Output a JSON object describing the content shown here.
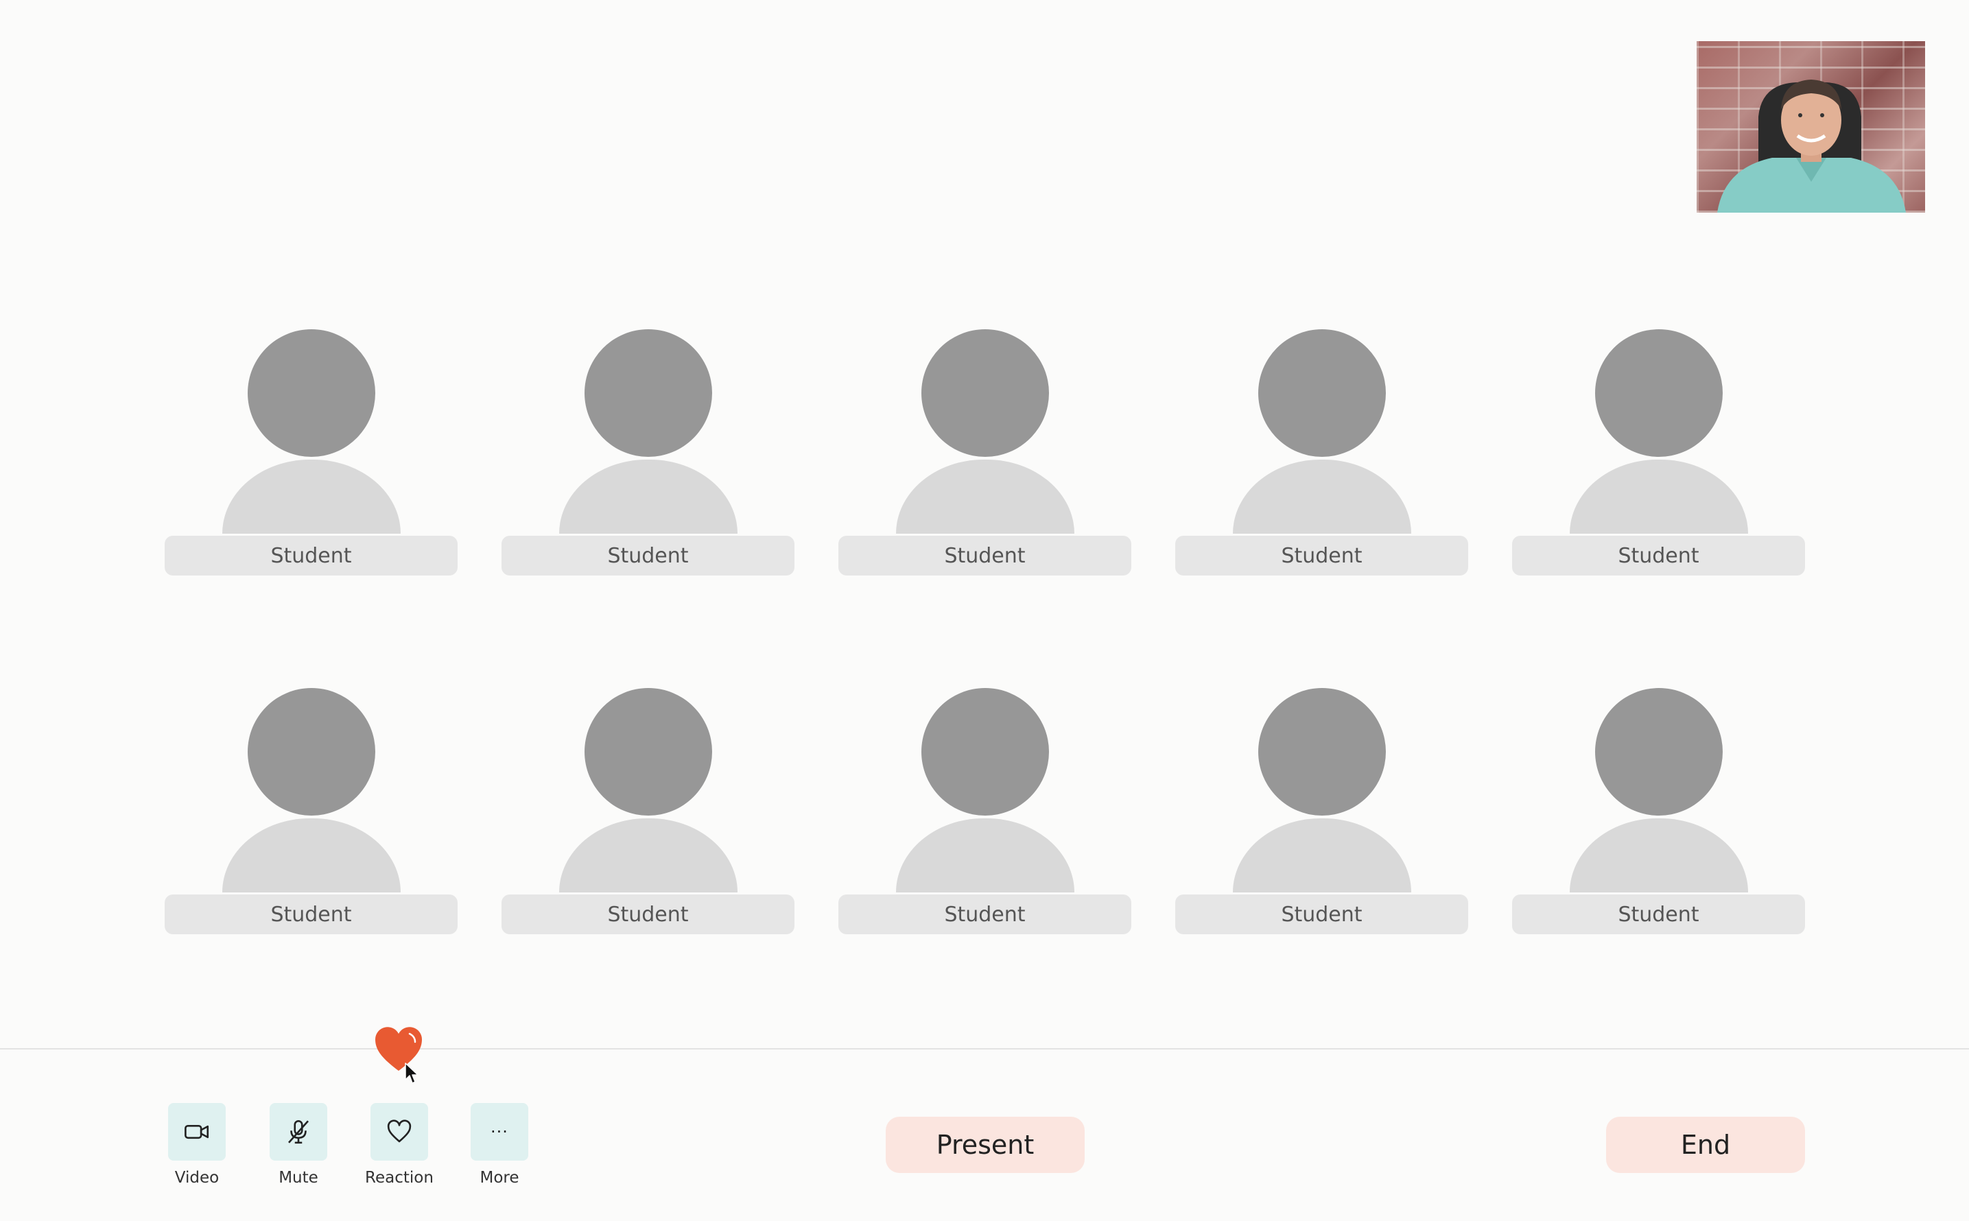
{
  "self_view": {
    "alt": "Presenter camera feed"
  },
  "students": [
    {
      "label": "Student"
    },
    {
      "label": "Student"
    },
    {
      "label": "Student"
    },
    {
      "label": "Student"
    },
    {
      "label": "Student"
    },
    {
      "label": "Student"
    },
    {
      "label": "Student"
    },
    {
      "label": "Student"
    },
    {
      "label": "Student"
    },
    {
      "label": "Student"
    }
  ],
  "controls": {
    "video_label": "Video",
    "mute_label": "Mute",
    "reaction_label": "Reaction",
    "more_label": "More",
    "more_glyph": "···"
  },
  "actions": {
    "present_label": "Present",
    "end_label": "End"
  },
  "colors": {
    "background": "#fbfbfa",
    "control_bg": "#dff1f0",
    "pill_bg": "#fbe5df",
    "heart": "#e85a32",
    "avatar_head": "#979797",
    "avatar_body": "#d9d9d9"
  },
  "icons": [
    "video-camera-icon",
    "microphone-off-icon",
    "heart-icon",
    "more-dots-icon",
    "heart-reaction-icon",
    "mouse-cursor-icon"
  ]
}
